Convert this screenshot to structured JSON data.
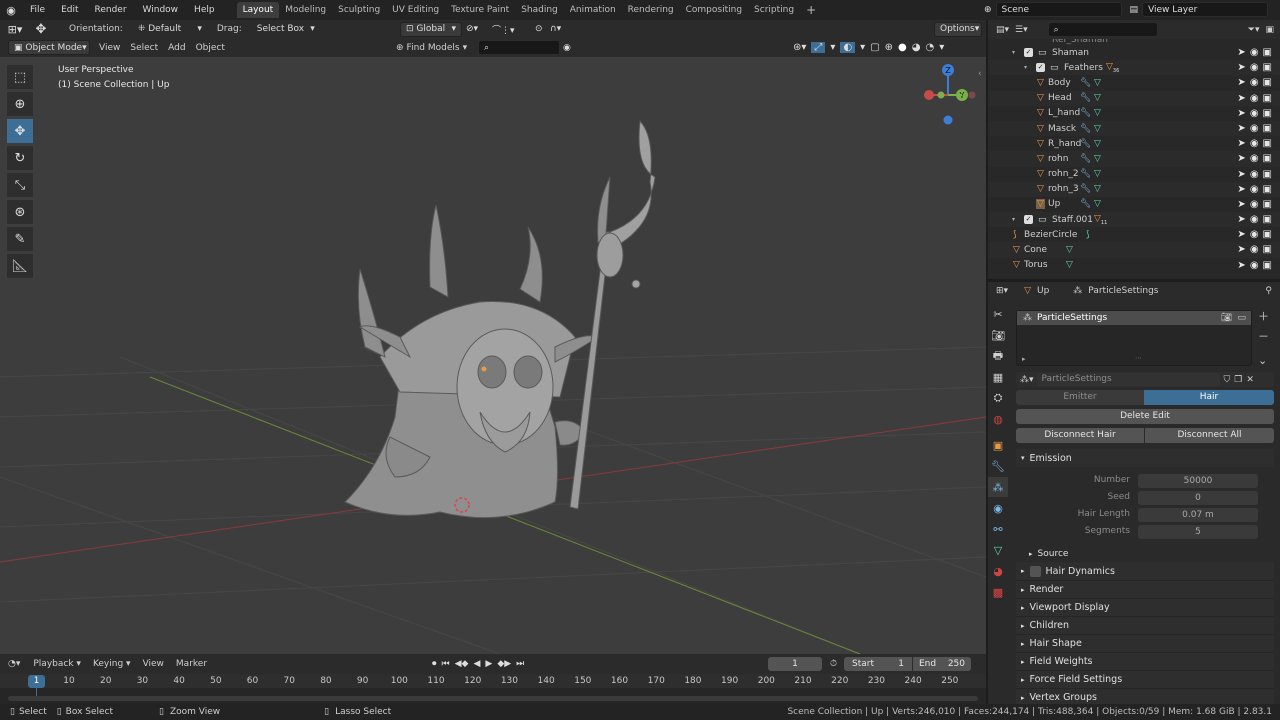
{
  "topbar": {
    "menus": [
      "File",
      "Edit",
      "Render",
      "Window",
      "Help"
    ],
    "workspaces": [
      "Layout",
      "Modeling",
      "Sculpting",
      "UV Editing",
      "Texture Paint",
      "Shading",
      "Animation",
      "Rendering",
      "Compositing",
      "Scripting"
    ],
    "active_workspace": "Layout",
    "add_tab": "+",
    "scene": "Scene",
    "view_layer": "View Layer"
  },
  "header": {
    "orientation_label": "Orientation:",
    "orientation_value": "Default",
    "drag_label": "Drag:",
    "drag_value": "Select Box",
    "transform_space": "Global",
    "options": "Options",
    "mode": "Object Mode",
    "menus": [
      "View",
      "Select",
      "Add",
      "Object"
    ],
    "find_models": "Find Models"
  },
  "viewport": {
    "perspective": "User Perspective",
    "collection": "(1) Scene Collection | Up",
    "gizmo_z": "Z",
    "gizmo_y": "Y"
  },
  "outliner": {
    "cut_top": "Ref_Shaman",
    "rows": [
      {
        "name": "Shaman",
        "indent": 2,
        "type": "collection",
        "check": true
      },
      {
        "name": "Feathers",
        "indent": 3,
        "type": "collection",
        "check": true,
        "badge": "36"
      },
      {
        "name": "Body",
        "indent": 3,
        "type": "object"
      },
      {
        "name": "Head",
        "indent": 3,
        "type": "object"
      },
      {
        "name": "L_hand",
        "indent": 3,
        "type": "object"
      },
      {
        "name": "Masck",
        "indent": 3,
        "type": "object"
      },
      {
        "name": "R_hand",
        "indent": 3,
        "type": "object"
      },
      {
        "name": "rohn",
        "indent": 3,
        "type": "object"
      },
      {
        "name": "rohn_2",
        "indent": 3,
        "type": "object"
      },
      {
        "name": "rohn_3",
        "indent": 3,
        "type": "object"
      },
      {
        "name": "Up",
        "indent": 3,
        "type": "object",
        "active": true
      },
      {
        "name": "Staff.001",
        "indent": 2,
        "type": "collection",
        "check": true,
        "badge": "11"
      },
      {
        "name": "BezierCircle",
        "indent": 1,
        "type": "curve"
      },
      {
        "name": "Cone",
        "indent": 1,
        "type": "object"
      },
      {
        "name": "Torus",
        "indent": 1,
        "type": "object"
      }
    ]
  },
  "properties": {
    "breadcrumb_object": "Up",
    "breadcrumb_settings": "ParticleSettings",
    "slot_name": "ParticleSettings",
    "datablock": "ParticleSettings",
    "type_emitter": "Emitter",
    "type_hair": "Hair",
    "delete_edit": "Delete Edit",
    "disconnect_hair": "Disconnect Hair",
    "disconnect_all": "Disconnect All",
    "emission_title": "Emission",
    "fields": [
      {
        "label": "Number",
        "value": "50000"
      },
      {
        "label": "Seed",
        "value": "0"
      },
      {
        "label": "Hair Length",
        "value": "0.07 m"
      },
      {
        "label": "Segments",
        "value": "5"
      }
    ],
    "source": "Source",
    "hair_dynamics": "Hair Dynamics",
    "sections": [
      "Render",
      "Viewport Display",
      "Children",
      "Hair Shape",
      "Field Weights",
      "Force Field Settings",
      "Vertex Groups"
    ]
  },
  "timeline": {
    "menus": [
      "Playback",
      "Keying",
      "View",
      "Marker"
    ],
    "current_frame": "1",
    "start_label": "Start",
    "start_value": "1",
    "end_label": "End",
    "end_value": "250",
    "ticks": [
      "10",
      "20",
      "30",
      "40",
      "50",
      "60",
      "70",
      "80",
      "90",
      "100",
      "110",
      "120",
      "130",
      "140",
      "150",
      "160",
      "170",
      "180",
      "190",
      "200",
      "210",
      "220",
      "230",
      "240",
      "250"
    ],
    "frame_marker": "1"
  },
  "status": {
    "select": "Select",
    "box_select": "Box Select",
    "zoom_view": "Zoom View",
    "lasso_select": "Lasso Select",
    "stats": "Scene Collection | Up | Verts:246,010 | Faces:244,174 | Tris:488,364 | Objects:0/59 | Mem: 1.68 GiB | 2.83.1"
  },
  "colors": {
    "accent": "#3d6e96",
    "object": "#e69a47",
    "modifier": "#7cb9e8",
    "mesh": "#5fd6b0",
    "x_axis": "#c84b4b",
    "y_axis": "#7ab04a",
    "z_axis": "#3d7ed6"
  }
}
